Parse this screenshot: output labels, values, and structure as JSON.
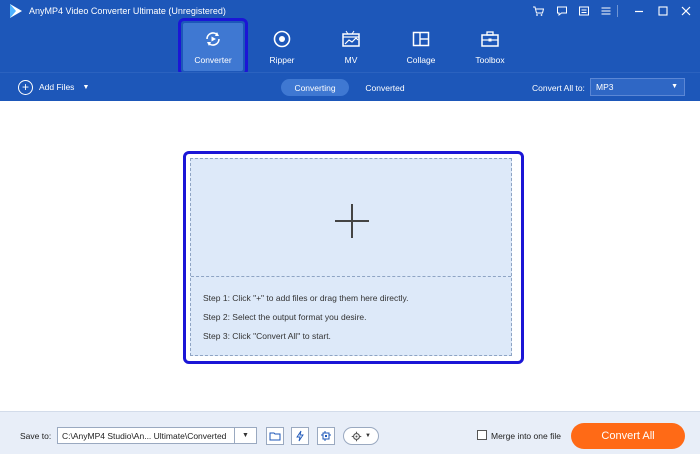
{
  "window": {
    "title": "AnyMP4 Video Converter Ultimate (Unregistered)",
    "controls": [
      "cart-icon",
      "chat-icon",
      "menu-icon",
      "minimize-icon",
      "maximize-icon",
      "close-icon"
    ]
  },
  "nav": {
    "items": [
      {
        "label": "Converter",
        "icon": "converter-icon",
        "active": true
      },
      {
        "label": "Ripper",
        "icon": "ripper-icon"
      },
      {
        "label": "MV",
        "icon": "mv-icon"
      },
      {
        "label": "Collage",
        "icon": "collage-icon"
      },
      {
        "label": "Toolbox",
        "icon": "toolbox-icon"
      }
    ]
  },
  "toolbar": {
    "add_files_label": "Add Files",
    "tabs": [
      {
        "label": "Converting",
        "active": true
      },
      {
        "label": "Converted"
      }
    ],
    "convert_all_to_label": "Convert All to:",
    "format_value": "MP3"
  },
  "drop_area": {
    "steps": [
      "Step 1: Click \"+\" to add files or drag them here directly.",
      "Step 2: Select the output format you desire.",
      "Step 3: Click \"Convert All\" to start."
    ]
  },
  "bottom": {
    "save_to_label": "Save to:",
    "save_path": "C:\\AnyMP4 Studio\\An... Ultimate\\Converted",
    "merge_label": "Merge into one file",
    "convert_all_button": "Convert All"
  },
  "colors": {
    "header_bg": "#1d57b9",
    "active_tab": "#3f78d2",
    "highlight_border": "#1b16d6",
    "drop_bg": "#dde9f9",
    "convert_button": "#ff6a16"
  }
}
